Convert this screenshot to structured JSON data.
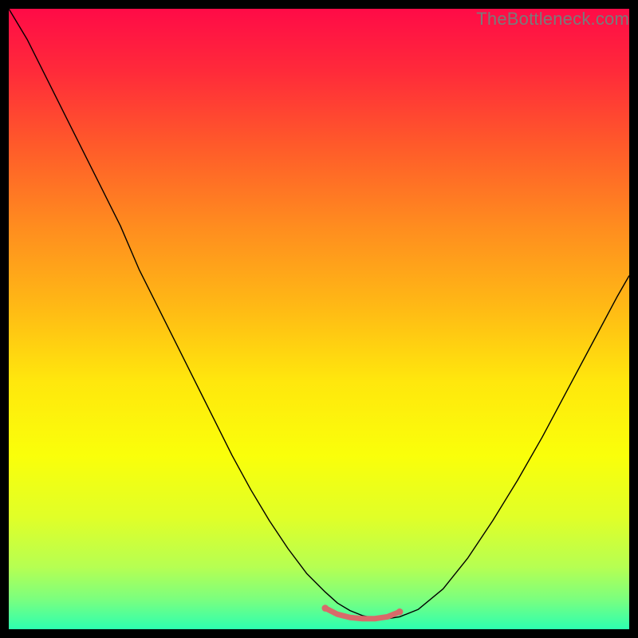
{
  "watermark": "TheBottleneck.com",
  "chart_data": {
    "type": "line",
    "title": "",
    "xlabel": "",
    "ylabel": "",
    "xlim": [
      0,
      100
    ],
    "ylim": [
      0,
      100
    ],
    "background_gradient": {
      "stops": [
        {
          "offset": 0.0,
          "color": "#ff0b47"
        },
        {
          "offset": 0.1,
          "color": "#ff2a3a"
        },
        {
          "offset": 0.22,
          "color": "#ff5a2a"
        },
        {
          "offset": 0.35,
          "color": "#ff8c1f"
        },
        {
          "offset": 0.48,
          "color": "#ffb915"
        },
        {
          "offset": 0.6,
          "color": "#ffe70d"
        },
        {
          "offset": 0.72,
          "color": "#faff0a"
        },
        {
          "offset": 0.82,
          "color": "#e0ff28"
        },
        {
          "offset": 0.9,
          "color": "#b6ff52"
        },
        {
          "offset": 0.95,
          "color": "#7dff7d"
        },
        {
          "offset": 1.0,
          "color": "#2dffb0"
        }
      ]
    },
    "series": [
      {
        "name": "curve",
        "color": "#000000",
        "width": 1.4,
        "x": [
          0.0,
          3,
          6,
          9,
          12,
          15,
          18,
          21,
          24,
          27,
          30,
          33,
          36,
          39,
          42,
          45,
          48,
          51,
          53,
          55,
          57,
          59,
          61,
          63,
          66,
          70,
          74,
          78,
          82,
          86,
          90,
          94,
          98,
          100
        ],
        "y": [
          100,
          95,
          89,
          83,
          77,
          71,
          65,
          58,
          52,
          46,
          40,
          34,
          28,
          22.5,
          17.5,
          13,
          9,
          6,
          4.2,
          3.0,
          2.2,
          1.8,
          1.7,
          2.0,
          3.2,
          6.5,
          11.5,
          17.5,
          24,
          31,
          38.5,
          46,
          53.5,
          57
        ]
      },
      {
        "name": "flat-segment",
        "color": "#d96a6a",
        "width": 7,
        "linecap": "round",
        "x": [
          51,
          53,
          55,
          57,
          59,
          61,
          63
        ],
        "y": [
          3.4,
          2.4,
          1.9,
          1.7,
          1.7,
          2.0,
          2.8
        ]
      }
    ],
    "annotations": []
  }
}
